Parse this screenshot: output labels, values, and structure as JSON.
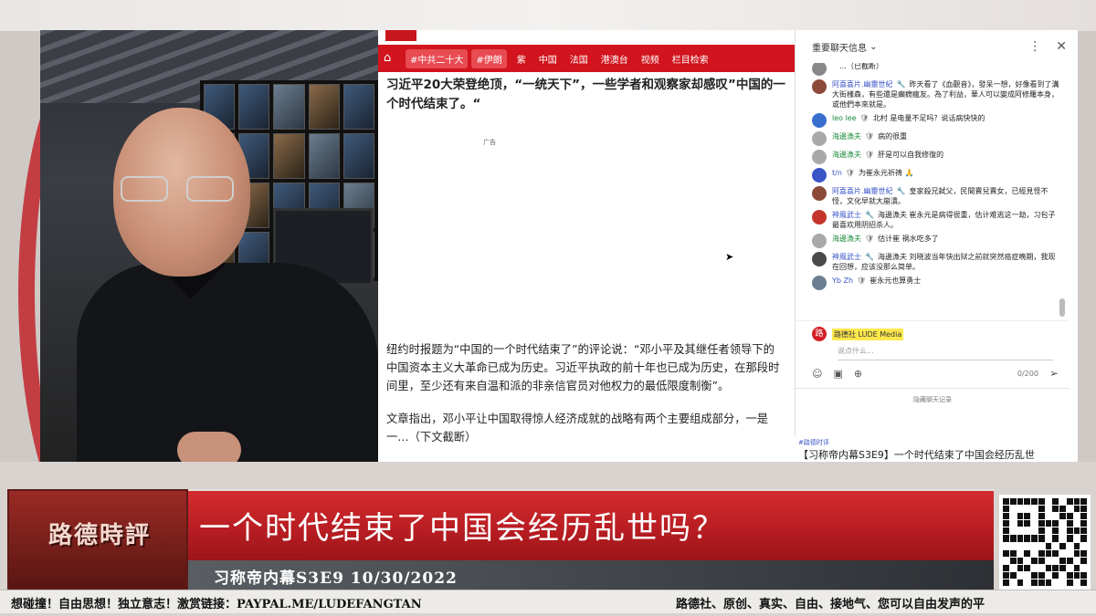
{
  "browser": {
    "nav": {
      "tags": [
        "#中共二十大",
        "#伊朗"
      ],
      "items": [
        "紫",
        "中国",
        "法国",
        "港澳台",
        "视频",
        "栏目检索"
      ]
    },
    "article": {
      "headline": "习近平20大荣登绝顶，“一统天下”，一些学者和观察家却感叹”中国的一个时代结束了。“",
      "ad_label": "广告",
      "para1": "纽约时报题为“中国的一个时代结束了”的评论说：“邓小平及其继任者领导下的中国资本主义大革命已成为历史。习近平执政的前十年也已成为历史，在那段时间里，至少还有来自温和派的非亲信官员对他权力的最低限度制衡”。",
      "para2": "文章指出，邓小平让中国取得惊人经济成就的战略有两个主要组成部分，一是一…（下文截断）"
    }
  },
  "chat": {
    "header": "重要聊天信息",
    "messages": [
      {
        "author": "",
        "badge": "",
        "text": "…（已截断）",
        "avatar_color": "#888888",
        "author_color": "green"
      },
      {
        "author": "阿喜喜片.幽靈世紀",
        "badge": "🔧",
        "text": "昨天看了《血觀音》，發呆一想，好像看到了溝大街樣森，有些還是癲癇瘋友。為了利益，華人可以變成阿修羅本身，或他們本來就是。",
        "avatar_color": "#8b4a3a",
        "author_color": "blue"
      },
      {
        "author": "leo lee",
        "badge": "🛡",
        "text": "北村 是电量不足吗？说话病快快的",
        "avatar_color": "#3a6fd0",
        "author_color": "green"
      },
      {
        "author": "海邊漁夫",
        "badge": "🛡",
        "text": "病的很重",
        "avatar_color": "#a9a9a9",
        "author_color": "green"
      },
      {
        "author": "海邊漁夫",
        "badge": "🛡",
        "text": "肝是可以自我修復的",
        "avatar_color": "#a9a9a9",
        "author_color": "green"
      },
      {
        "author": "t/n",
        "badge": "🛡",
        "text": "为崔永元祈祷 🙏",
        "avatar_color": "#3a55c8",
        "author_color": "blue"
      },
      {
        "author": "阿喜喜片.幽靈世紀",
        "badge": "🔧",
        "text": "皇家殺兄弑父，民間賣兒賣女，已經見怪不怪，文化早就大崩潰。",
        "avatar_color": "#8b4a3a",
        "author_color": "blue"
      },
      {
        "author": "神風武士",
        "badge": "🔧",
        "text": "海邊漁夫 崔永元是病得很重，估计难逃这一劫，习包子最喜欢用阴招杀人。",
        "avatar_color": "#c4342c",
        "author_color": "blue"
      },
      {
        "author": "海邊漁夫",
        "badge": "🛡",
        "text": "估计崔 祸水吃多了",
        "avatar_color": "#a9a9a9",
        "author_color": "green"
      },
      {
        "author": "神風武士",
        "badge": "🔧",
        "text": "海邊漁夫 刘晓波当年快出狱之前就突然癌症晚期，我现在回想，应该没那么简单。",
        "avatar_color": "#4a4a4a",
        "author_color": "blue"
      },
      {
        "author": "Yb Zh",
        "badge": "🛡",
        "text": "崔永元也算勇士",
        "avatar_color": "#6b7e92",
        "author_color": "blue"
      }
    ],
    "composer": {
      "avatar_letter": "路",
      "me_name": "路德社 LUDE Media",
      "placeholder": "说点什么...",
      "counter": "0/200",
      "hide_label": "隐藏聊天记录"
    }
  },
  "video_strip": {
    "hashtag": "#路德时评",
    "title": "【习称帝内幕S3E9】一个时代结束了中国会经历乱世"
  },
  "lower_third": {
    "logo_text": "路德時評",
    "headline": "一个时代结束了中国会经历乱世吗？",
    "subtitle": "习称帝内幕S3E9 10/30/2022",
    "ticker_left": "想碰撞！自由思想！独立意志！激赏链接：PAYPAL.ME/LUDEFANGTAN",
    "ticker_right": "路德社、原创、真实、自由、接地气、您可以自由发声的平"
  },
  "icons": {
    "home": "home-icon",
    "more": "more-vert-icon",
    "close": "close-icon",
    "emoji": "emoji-icon",
    "money": "super-chat-icon",
    "add": "add-icon",
    "send": "send-icon",
    "chevron": "chevron-down-icon"
  },
  "colors": {
    "brand_red": "#d1141d",
    "banner_red": "#c1262b"
  }
}
